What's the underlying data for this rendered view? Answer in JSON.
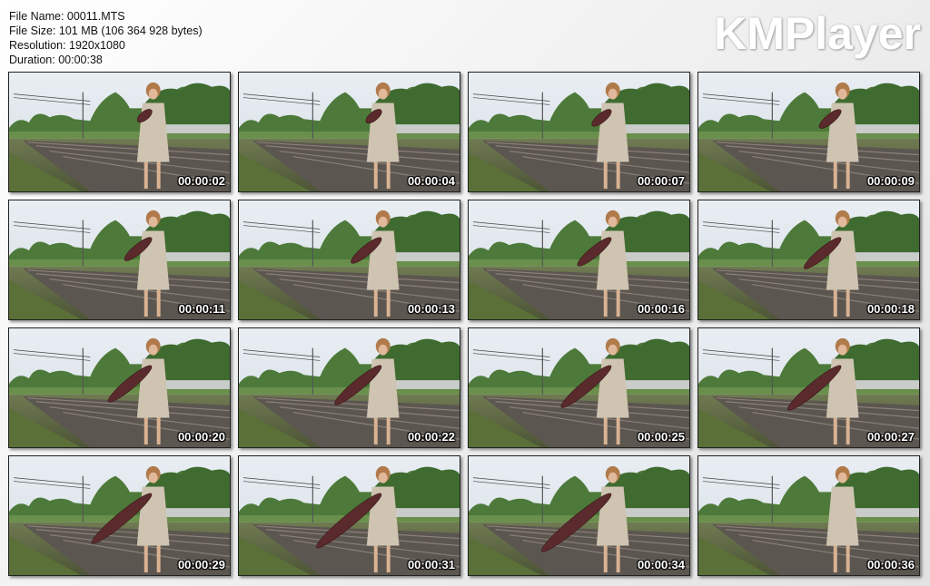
{
  "file_info": {
    "name": "File Name: 00011.MTS",
    "size": "File Size: 101 MB (106 364 928 bytes)",
    "resolution": "Resolution: 1920x1080",
    "duration": "Duration: 00:00:38"
  },
  "brand": "KMPlayer",
  "thumbnails": [
    {
      "time": "00:00:02",
      "balloon": 0.1
    },
    {
      "time": "00:00:04",
      "balloon": 0.12
    },
    {
      "time": "00:00:07",
      "balloon": 0.18
    },
    {
      "time": "00:00:09",
      "balloon": 0.22
    },
    {
      "time": "00:00:11",
      "balloon": 0.3
    },
    {
      "time": "00:00:13",
      "balloon": 0.35
    },
    {
      "time": "00:00:16",
      "balloon": 0.4
    },
    {
      "time": "00:00:18",
      "balloon": 0.45
    },
    {
      "time": "00:00:20",
      "balloon": 0.55
    },
    {
      "time": "00:00:22",
      "balloon": 0.6
    },
    {
      "time": "00:00:25",
      "balloon": 0.65
    },
    {
      "time": "00:00:27",
      "balloon": 0.7
    },
    {
      "time": "00:00:29",
      "balloon": 0.8
    },
    {
      "time": "00:00:31",
      "balloon": 0.88
    },
    {
      "time": "00:00:34",
      "balloon": 0.95
    },
    {
      "time": "00:00:36",
      "balloon": 0.0
    }
  ]
}
